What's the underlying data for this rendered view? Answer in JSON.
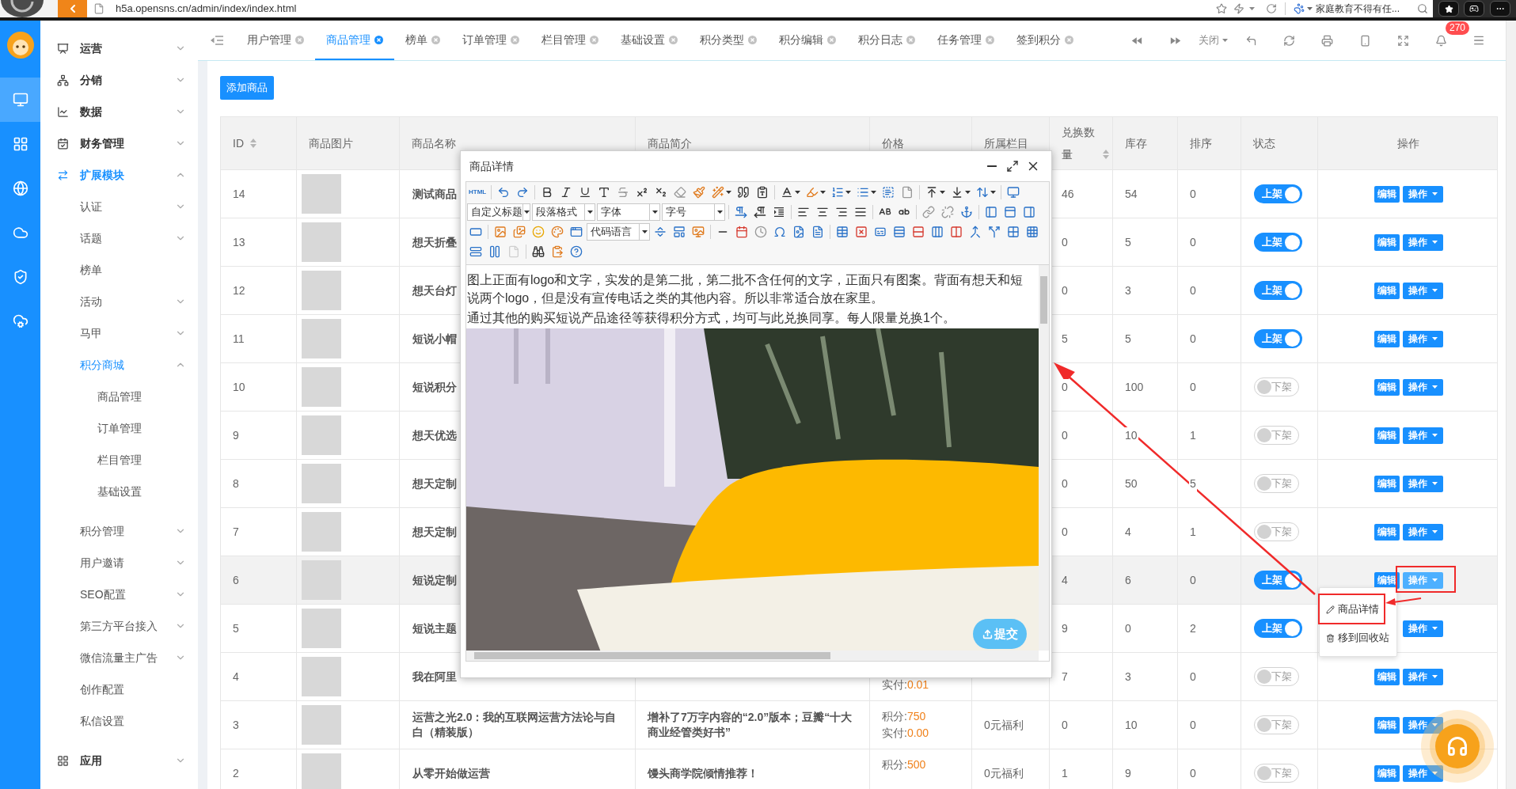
{
  "browser": {
    "url": "h5a.opensns.cn/admin/index/index.html",
    "search_text": "家庭教育不得有任..."
  },
  "rail": {
    "items": [
      {
        "selected": true
      },
      {
        "selected": false
      },
      {
        "selected": false
      },
      {
        "selected": false
      },
      {
        "selected": false
      },
      {
        "selected": false
      }
    ]
  },
  "sidebar": {
    "items": [
      {
        "label": "运营",
        "selected": false,
        "expanded": false
      },
      {
        "label": "分销",
        "selected": false,
        "expanded": false
      },
      {
        "label": "数据",
        "selected": false,
        "expanded": false
      },
      {
        "label": "财务管理",
        "selected": false,
        "expanded": false
      },
      {
        "label": "扩展模块",
        "selected": true,
        "expanded": true,
        "children": [
          {
            "label": "认证",
            "selected": false,
            "expanded": false
          },
          {
            "label": "话题",
            "selected": false,
            "expanded": false
          },
          {
            "label": "榜单",
            "selected": false
          },
          {
            "label": "活动",
            "selected": false,
            "expanded": false
          },
          {
            "label": "马甲",
            "selected": false,
            "expanded": false
          },
          {
            "label": "积分商城",
            "selected": true,
            "expanded": true,
            "children": [
              {
                "label": "商品管理",
                "selected": false
              },
              {
                "label": "订单管理",
                "selected": false
              },
              {
                "label": "栏目管理",
                "selected": false
              },
              {
                "label": "基础设置",
                "selected": false
              }
            ]
          },
          {
            "label": "积分管理",
            "selected": false,
            "expanded": false
          },
          {
            "label": "用户邀请",
            "selected": false,
            "expanded": false
          },
          {
            "label": "SEO配置",
            "selected": false,
            "expanded": false
          },
          {
            "label": "第三方平台接入",
            "selected": false,
            "expanded": false
          },
          {
            "label": "微信流量主广告",
            "selected": false,
            "expanded": false
          },
          {
            "label": "创作配置",
            "selected": false
          },
          {
            "label": "私信设置",
            "selected": false
          }
        ]
      },
      {
        "label": "应用",
        "selected": false,
        "expanded": false
      }
    ]
  },
  "tabs": [
    {
      "label": "用户管理",
      "selected": false
    },
    {
      "label": "商品管理",
      "selected": true
    },
    {
      "label": "榜单",
      "selected": false
    },
    {
      "label": "订单管理",
      "selected": false
    },
    {
      "label": "栏目管理",
      "selected": false
    },
    {
      "label": "基础设置",
      "selected": false
    },
    {
      "label": "积分类型",
      "selected": false
    },
    {
      "label": "积分编辑",
      "selected": false
    },
    {
      "label": "积分日志",
      "selected": false
    },
    {
      "label": "任务管理",
      "selected": false
    },
    {
      "label": "签到积分",
      "selected": false
    }
  ],
  "tabbar": {
    "close_label": "关闭",
    "badge": "270"
  },
  "add_button": "添加商品",
  "table": {
    "columns": [
      {
        "label": "ID",
        "sortable": true
      },
      {
        "label": "商品图片",
        "sortable": false
      },
      {
        "label": "商品名称",
        "sortable": false
      },
      {
        "label": "商品简介",
        "sortable": false
      },
      {
        "label": "价格",
        "sortable": false
      },
      {
        "label": "所属栏目",
        "sortable": false
      },
      {
        "label": "兑换数量",
        "sortable": true
      },
      {
        "label": "库存",
        "sortable": false
      },
      {
        "label": "排序",
        "sortable": false
      },
      {
        "label": "状态",
        "sortable": false
      },
      {
        "label": "操作",
        "sortable": false
      }
    ],
    "rows": [
      {
        "id": "14",
        "name": "测试商品",
        "exchanged": "46",
        "stock": "54",
        "sort": "0",
        "status": {
          "on": true,
          "label": "上架"
        },
        "edit": "编辑",
        "action": "操作",
        "highlighted": false,
        "menu_open": false
      },
      {
        "id": "13",
        "name": "想天折叠",
        "exchanged": "0",
        "stock": "5",
        "sort": "0",
        "status": {
          "on": true,
          "label": "上架"
        },
        "edit": "编辑",
        "action": "操作",
        "highlighted": false,
        "menu_open": false
      },
      {
        "id": "12",
        "name": "想天台灯",
        "exchanged": "0",
        "stock": "3",
        "sort": "0",
        "status": {
          "on": true,
          "label": "上架"
        },
        "edit": "编辑",
        "action": "操作",
        "highlighted": false,
        "menu_open": false
      },
      {
        "id": "11",
        "name": "短说小帽",
        "exchanged": "5",
        "stock": "5",
        "sort": "0",
        "status": {
          "on": true,
          "label": "上架"
        },
        "edit": "编辑",
        "action": "操作",
        "highlighted": false,
        "menu_open": false
      },
      {
        "id": "10",
        "name": "短说积分",
        "exchanged": "0",
        "stock": "100",
        "sort": "0",
        "status": {
          "on": false,
          "label": "下架"
        },
        "edit": "编辑",
        "action": "操作",
        "highlighted": false,
        "menu_open": false
      },
      {
        "id": "9",
        "name": "想天优选",
        "exchanged": "0",
        "stock": "10",
        "sort": "1",
        "status": {
          "on": false,
          "label": "下架"
        },
        "edit": "编辑",
        "action": "操作",
        "highlighted": false,
        "menu_open": false
      },
      {
        "id": "8",
        "name": "想天定制",
        "exchanged": "0",
        "stock": "50",
        "sort": "5",
        "status": {
          "on": false,
          "label": "下架"
        },
        "edit": "编辑",
        "action": "操作",
        "highlighted": false,
        "menu_open": false
      },
      {
        "id": "7",
        "name": "想天定制",
        "exchanged": "0",
        "stock": "4",
        "sort": "1",
        "status": {
          "on": false,
          "label": "下架"
        },
        "edit": "编辑",
        "action": "操作",
        "highlighted": false,
        "menu_open": false
      },
      {
        "id": "6",
        "name": "短说定制",
        "exchanged": "4",
        "stock": "6",
        "sort": "0",
        "status": {
          "on": true,
          "label": "上架"
        },
        "edit": "编辑",
        "action": "操作",
        "highlighted": true,
        "menu_open": true
      },
      {
        "id": "5",
        "name": "短说主题",
        "exchanged": "9",
        "stock": "0",
        "sort": "2",
        "status": {
          "on": true,
          "label": "上架"
        },
        "action": "操作",
        "highlighted": false,
        "menu_open": false
      },
      {
        "id": "4",
        "name": "我在阿里",
        "price": [
          {
            "kind": "paid",
            "label": "实付:",
            "value": "0.01"
          }
        ],
        "exchanged": "7",
        "stock": "3",
        "sort": "0",
        "status": {
          "on": false,
          "label": "下架"
        },
        "edit": "编辑",
        "action": "操作",
        "highlighted": false,
        "menu_open": false
      },
      {
        "id": "3",
        "name": "运营之光2.0：我的互联网运营方法论与自白（精装版）",
        "description": "增补了7万字内容的“2.0”版本；豆瓣“十大商业经管类好书”",
        "price": [
          {
            "kind": "points",
            "label": "积分:",
            "value": "750"
          },
          {
            "kind": "paid",
            "label": "实付:",
            "value": "0.00"
          }
        ],
        "category": "0元福利",
        "exchanged": "0",
        "stock": "10",
        "sort": "0",
        "status": {
          "on": false,
          "label": "下架"
        },
        "edit": "编辑",
        "action": "操作",
        "highlighted": false,
        "menu_open": false
      },
      {
        "id": "2",
        "name": "从零开始做运营",
        "description": "馒头商学院倾情推荐！",
        "price": [
          {
            "kind": "points",
            "label": "积分:",
            "value": "500"
          }
        ],
        "category": "0元福利",
        "exchanged": "1",
        "stock": "9",
        "sort": "0",
        "status": {
          "on": false,
          "label": "下架"
        },
        "edit": "编辑",
        "action": "操作",
        "highlighted": false,
        "menu_open": false
      }
    ],
    "action_menu": [
      {
        "kind": "edit",
        "label": "商品详情"
      },
      {
        "kind": "delete",
        "label": "移到回收站"
      }
    ]
  },
  "dialog": {
    "title": "商品详情",
    "source_label": "HTML",
    "selects": [
      "自定义标题",
      "段落格式",
      "字体",
      "字号",
      "代码语言"
    ],
    "paragraphs": [
      "图上正面有logo和文字，实发的是第二批，第二批不含任何的文字，正面只有图案。背面有想天和短说两个logo，但是没有宣传电话之类的其他内容。所以非常适合放在家里。",
      "通过其他的购买短说产品途径等获得积分方式，均可与此兑换同享。每人限量兑换1个。"
    ],
    "submit": "提交"
  }
}
